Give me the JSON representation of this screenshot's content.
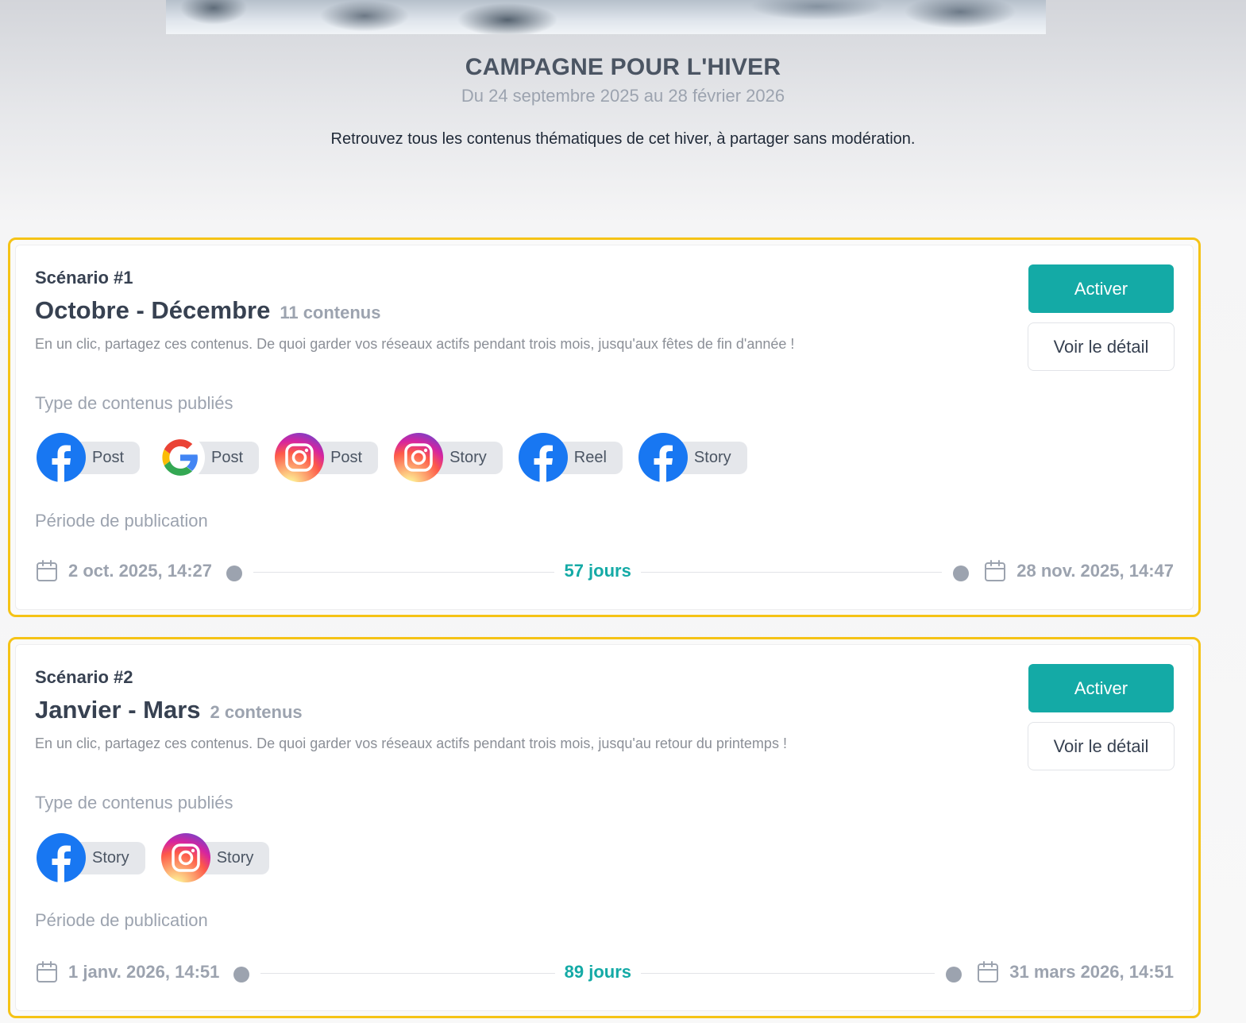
{
  "campaign": {
    "title": "CAMPAGNE POUR L'HIVER",
    "dates": "Du 24 septembre 2025 au 28 février 2026",
    "description": "Retrouvez tous les contenus thématiques de cet hiver, à partager sans modération."
  },
  "labels": {
    "types_heading": "Type de contenus publiés",
    "period_heading": "Période de publication",
    "activate": "Activer",
    "detail": "Voir le détail"
  },
  "colors": {
    "accent": "#14aaa6",
    "highlight_border": "#f5c316",
    "facebook": "#1877f2"
  },
  "scenarios": [
    {
      "label": "Scénario #1",
      "name": "Octobre - Décembre",
      "count": "11 contenus",
      "description": "En un clic, partagez ces contenus. De quoi garder vos réseaux actifs pendant trois mois, jusqu'aux fêtes de fin d'année !",
      "types": [
        {
          "network": "facebook-icon",
          "label": "Post"
        },
        {
          "network": "google-icon",
          "label": "Post"
        },
        {
          "network": "instagram-icon",
          "label": "Post"
        },
        {
          "network": "instagram-icon",
          "label": "Story"
        },
        {
          "network": "facebook-icon",
          "label": "Reel"
        },
        {
          "network": "facebook-icon",
          "label": "Story"
        }
      ],
      "start": "2 oct. 2025, 14:27",
      "end": "28 nov. 2025, 14:47",
      "duration": "57 jours"
    },
    {
      "label": "Scénario #2",
      "name": "Janvier - Mars",
      "count": "2 contenus",
      "description": "En un clic, partagez ces contenus. De quoi garder vos réseaux actifs pendant trois mois, jusqu'au retour du printemps !",
      "types": [
        {
          "network": "facebook-icon",
          "label": "Story"
        },
        {
          "network": "instagram-icon",
          "label": "Story"
        }
      ],
      "start": "1 janv. 2026, 14:51",
      "end": "31 mars 2026, 14:51",
      "duration": "89 jours"
    }
  ]
}
